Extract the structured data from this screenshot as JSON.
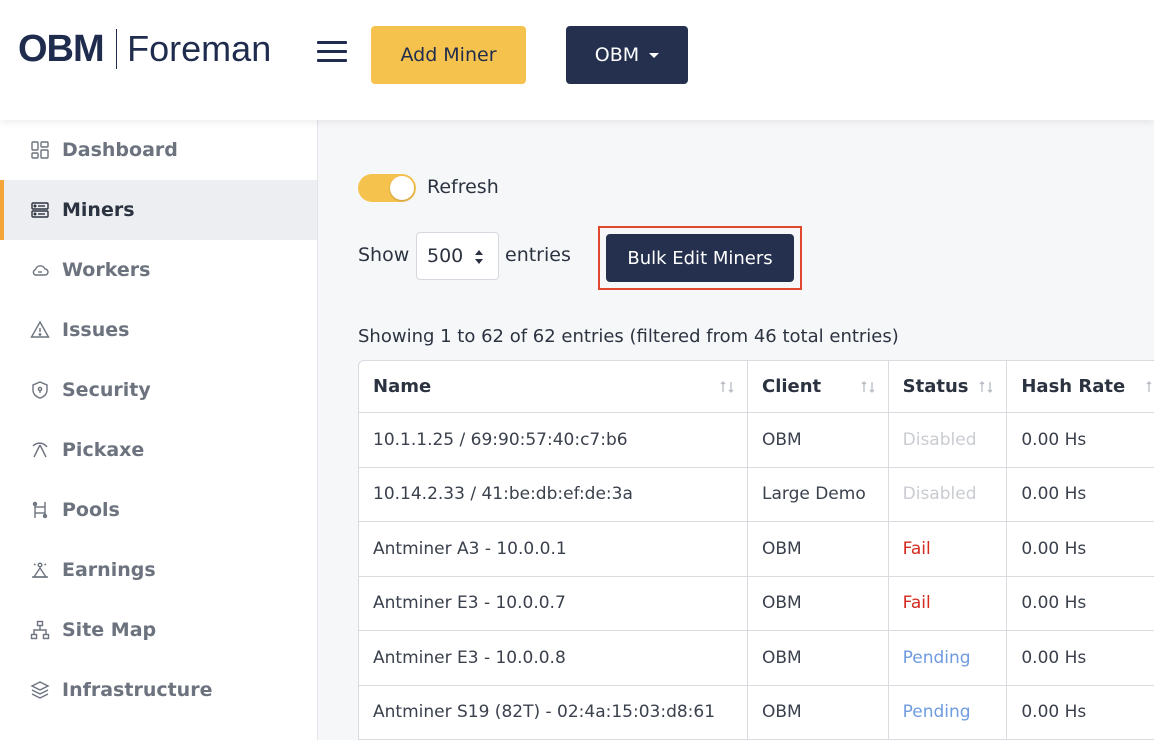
{
  "header": {
    "logo_obm": "OBM",
    "logo_foreman": "Foreman",
    "add_miner_label": "Add Miner",
    "org_label": "OBM"
  },
  "sidebar": {
    "items": [
      {
        "label": "Dashboard",
        "icon": "dashboard-icon"
      },
      {
        "label": "Miners",
        "icon": "server-icon",
        "active": true
      },
      {
        "label": "Workers",
        "icon": "cloud-icon"
      },
      {
        "label": "Issues",
        "icon": "warning-icon"
      },
      {
        "label": "Security",
        "icon": "shield-icon"
      },
      {
        "label": "Pickaxe",
        "icon": "pickaxe-icon"
      },
      {
        "label": "Pools",
        "icon": "pools-icon"
      },
      {
        "label": "Earnings",
        "icon": "earnings-icon"
      },
      {
        "label": "Site Map",
        "icon": "sitemap-icon"
      },
      {
        "label": "Infrastructure",
        "icon": "layers-icon"
      }
    ]
  },
  "main": {
    "refresh_label": "Refresh",
    "refresh_on": true,
    "show_label": "Show",
    "entries_value": "500",
    "entries_label": "entries",
    "bulk_edit_label": "Bulk Edit Miners",
    "showing_text": "Showing 1 to 62 of 62 entries (filtered from 46 total entries)"
  },
  "table": {
    "columns": [
      "Name",
      "Client",
      "Status",
      "Hash Rate"
    ],
    "rows": [
      {
        "name": "10.1.1.25 / 69:90:57:40:c7:b6",
        "client": "OBM",
        "status": "Disabled",
        "hashrate": "0.00 Hs"
      },
      {
        "name": "10.14.2.33 / 41:be:db:ef:de:3a",
        "client": "Large Demo",
        "status": "Disabled",
        "hashrate": "0.00 Hs"
      },
      {
        "name": "Antminer A3 - 10.0.0.1",
        "client": "OBM",
        "status": "Fail",
        "hashrate": "0.00 Hs"
      },
      {
        "name": "Antminer E3 - 10.0.0.7",
        "client": "OBM",
        "status": "Fail",
        "hashrate": "0.00 Hs"
      },
      {
        "name": "Antminer E3 - 10.0.0.8",
        "client": "OBM",
        "status": "Pending",
        "hashrate": "0.00 Hs"
      },
      {
        "name": "Antminer S19 (82T) - 02:4a:15:03:d8:61",
        "client": "OBM",
        "status": "Pending",
        "hashrate": "0.00 Hs"
      }
    ]
  },
  "colors": {
    "accent_yellow": "#f5c24e",
    "navy": "#24304e",
    "active_bar": "#f5a43a",
    "fail": "#d42a1f",
    "pending": "#6f9be0",
    "disabled": "#c9ccd1",
    "highlight_box": "#e1492f"
  }
}
